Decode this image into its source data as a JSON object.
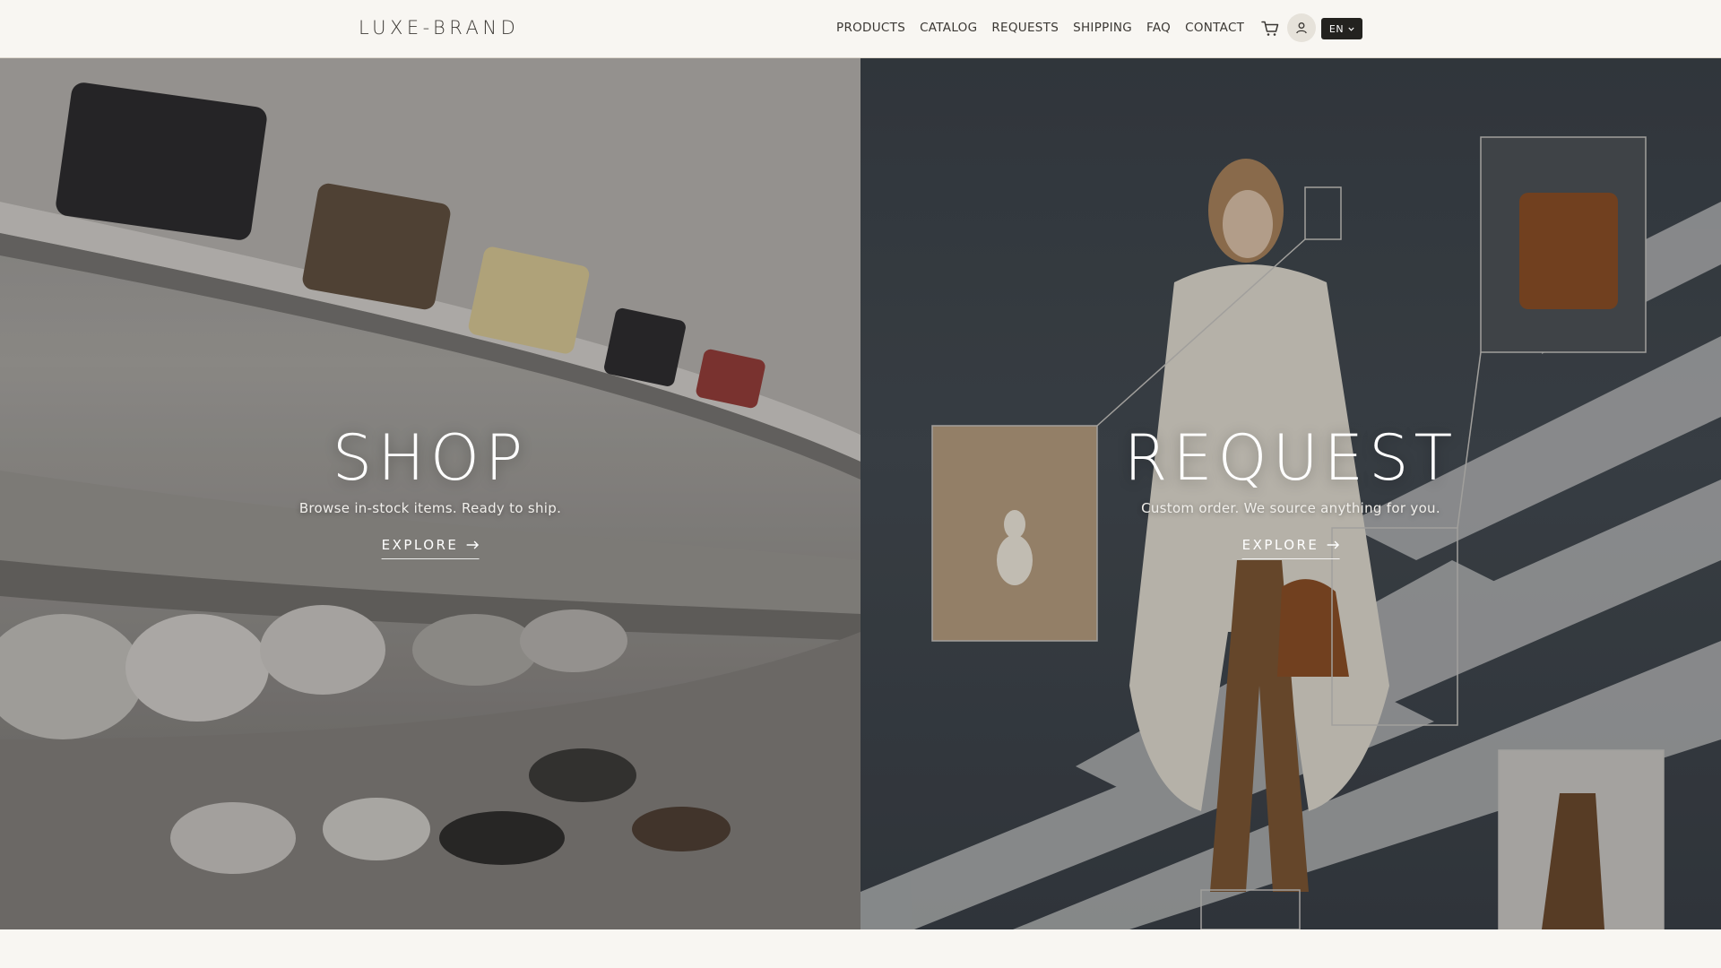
{
  "header": {
    "logo": "LUXE-BRAND",
    "nav": [
      "PRODUCTS",
      "CATALOG",
      "REQUESTS",
      "SHIPPING",
      "FAQ",
      "CONTACT"
    ],
    "cart_icon": "cart-icon",
    "user_icon": "user-icon",
    "language": "EN",
    "language_icon": "chevron-down-icon"
  },
  "hero": {
    "shop": {
      "title": "SHOP",
      "subtitle": "Browse in-stock items. Ready to ship.",
      "cta": "EXPLORE",
      "cta_icon": "arrow-right-icon"
    },
    "request": {
      "title": "REQUEST",
      "subtitle": "Custom order. We source anything for you.",
      "cta": "EXPLORE",
      "cta_icon": "arrow-right-icon"
    }
  },
  "colors": {
    "background": "#f8f6f2",
    "text_dark": "#3a3733",
    "lang_badge": "#23221f",
    "hero_text": "#ffffff"
  }
}
